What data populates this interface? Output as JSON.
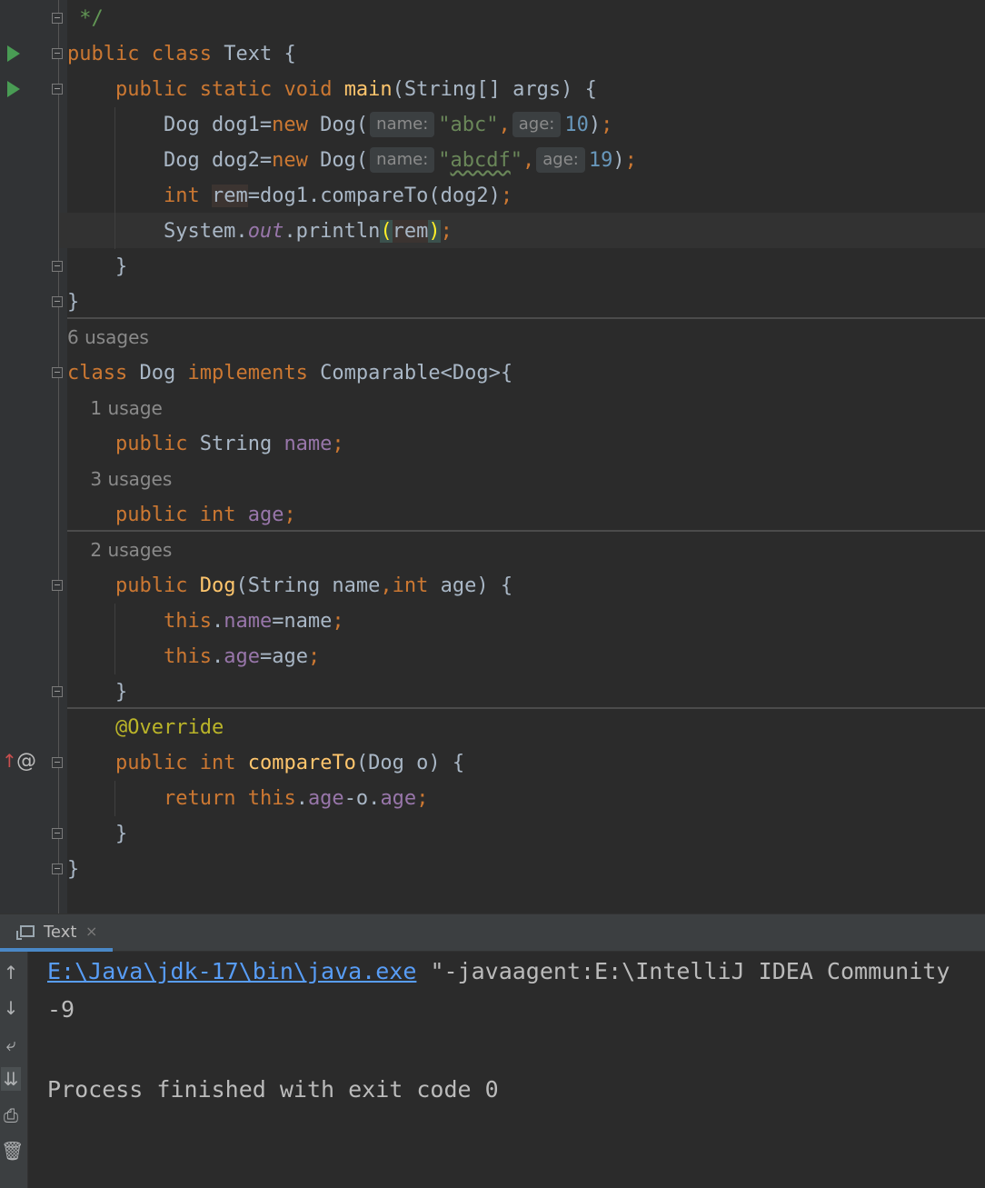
{
  "editor": {
    "lines": [
      {
        "segments": [
          {
            "t": " */",
            "c": "cmt"
          }
        ]
      },
      {
        "segments": [
          {
            "t": "public",
            "c": "kw"
          },
          {
            "t": " "
          },
          {
            "t": "class",
            "c": "kw"
          },
          {
            "t": " Text {"
          }
        ]
      },
      {
        "segments": [
          {
            "t": "    "
          },
          {
            "t": "public",
            "c": "kw"
          },
          {
            "t": " "
          },
          {
            "t": "static",
            "c": "kw"
          },
          {
            "t": " "
          },
          {
            "t": "void",
            "c": "kw"
          },
          {
            "t": " "
          },
          {
            "t": "main",
            "c": "fn"
          },
          {
            "t": "(String[] args) {"
          }
        ]
      },
      {
        "segments": [
          {
            "t": "        Dog dog1="
          },
          {
            "t": "new",
            "c": "kw"
          },
          {
            "t": " Dog("
          },
          {
            "hint": "name:"
          },
          {
            "t": "\"abc\"",
            "c": "str"
          },
          {
            "t": ",",
            "c": "kw"
          },
          {
            "hint": "age:"
          },
          {
            "t": "10",
            "c": "num"
          },
          {
            "t": ")"
          },
          {
            "t": ";",
            "c": "kw"
          }
        ]
      },
      {
        "segments": [
          {
            "t": "        Dog dog2="
          },
          {
            "t": "new",
            "c": "kw"
          },
          {
            "t": " Dog("
          },
          {
            "hint": "name:"
          },
          {
            "t": "\"",
            "c": "str"
          },
          {
            "t": "abcdf",
            "c": "str squiggle"
          },
          {
            "t": "\"",
            "c": "str"
          },
          {
            "t": ",",
            "c": "kw"
          },
          {
            "hint": "age:"
          },
          {
            "t": "19",
            "c": "num"
          },
          {
            "t": ")"
          },
          {
            "t": ";",
            "c": "kw"
          }
        ]
      },
      {
        "segments": [
          {
            "t": "        "
          },
          {
            "t": "int",
            "c": "kw"
          },
          {
            "t": " "
          },
          {
            "t": "rem",
            "c": "rem-hl"
          },
          {
            "t": "=dog1.compareTo(dog2)"
          },
          {
            "t": ";",
            "c": "kw"
          }
        ]
      },
      {
        "segments": [
          {
            "t": "        System."
          },
          {
            "t": "out",
            "c": "static-field"
          },
          {
            "t": ".println"
          },
          {
            "t": "(",
            "c": "bracket-hl"
          },
          {
            "t": "rem",
            "c": "rem-hl"
          },
          {
            "t": ")",
            "c": "bracket-hl"
          },
          {
            "t": ";",
            "c": "kw"
          }
        ]
      },
      {
        "segments": [
          {
            "t": "    }"
          }
        ]
      },
      {
        "segments": [
          {
            "t": "}"
          }
        ]
      },
      {
        "hint_line": "6 usages"
      },
      {
        "segments": [
          {
            "t": "class",
            "c": "kw"
          },
          {
            "t": " Dog "
          },
          {
            "t": "implements",
            "c": "kw"
          },
          {
            "t": " Comparable<Dog>{"
          }
        ]
      },
      {
        "hint_line": "    1 usage"
      },
      {
        "segments": [
          {
            "t": "    "
          },
          {
            "t": "public",
            "c": "kw"
          },
          {
            "t": " String "
          },
          {
            "t": "name",
            "c": "field"
          },
          {
            "t": ";",
            "c": "kw"
          }
        ]
      },
      {
        "hint_line": "    3 usages"
      },
      {
        "segments": [
          {
            "t": "    "
          },
          {
            "t": "public",
            "c": "kw"
          },
          {
            "t": " "
          },
          {
            "t": "int",
            "c": "kw"
          },
          {
            "t": " "
          },
          {
            "t": "age",
            "c": "field"
          },
          {
            "t": ";",
            "c": "kw"
          }
        ]
      },
      {
        "hint_line": "    2 usages"
      },
      {
        "segments": [
          {
            "t": "    "
          },
          {
            "t": "public",
            "c": "kw"
          },
          {
            "t": " "
          },
          {
            "t": "Dog",
            "c": "fn"
          },
          {
            "t": "(String name"
          },
          {
            "t": ",",
            "c": "kw"
          },
          {
            "t": "int",
            "c": "kw"
          },
          {
            "t": " age) {"
          }
        ]
      },
      {
        "segments": [
          {
            "t": "        "
          },
          {
            "t": "this",
            "c": "kw"
          },
          {
            "t": "."
          },
          {
            "t": "name",
            "c": "field"
          },
          {
            "t": "=name"
          },
          {
            "t": ";",
            "c": "kw"
          }
        ]
      },
      {
        "segments": [
          {
            "t": "        "
          },
          {
            "t": "this",
            "c": "kw"
          },
          {
            "t": "."
          },
          {
            "t": "age",
            "c": "field"
          },
          {
            "t": "=age"
          },
          {
            "t": ";",
            "c": "kw"
          }
        ]
      },
      {
        "segments": [
          {
            "t": "    }"
          }
        ]
      },
      {
        "segments": [
          {
            "t": "    "
          },
          {
            "t": "@Override",
            "c": "ann"
          }
        ]
      },
      {
        "segments": [
          {
            "t": "    "
          },
          {
            "t": "public",
            "c": "kw"
          },
          {
            "t": " "
          },
          {
            "t": "int",
            "c": "kw"
          },
          {
            "t": " "
          },
          {
            "t": "compareTo",
            "c": "fn"
          },
          {
            "t": "(Dog o) {"
          }
        ]
      },
      {
        "segments": [
          {
            "t": "        "
          },
          {
            "t": "return",
            "c": "kw"
          },
          {
            "t": " "
          },
          {
            "t": "this",
            "c": "kw"
          },
          {
            "t": "."
          },
          {
            "t": "age",
            "c": "field"
          },
          {
            "t": "-o."
          },
          {
            "t": "age",
            "c": "field"
          },
          {
            "t": ";",
            "c": "kw"
          }
        ]
      },
      {
        "segments": [
          {
            "t": "    }"
          }
        ]
      },
      {
        "segments": [
          {
            "t": "}"
          }
        ]
      }
    ],
    "gutter_icons": {
      "run": "run-arrow-icon",
      "override": "overriding-method-icon",
      "annotation": "at-sign-icon"
    }
  },
  "run_panel": {
    "tab_label": "Text",
    "tab_close": "×",
    "console": {
      "command_link": "E:\\Java\\jdk-17\\bin\\java.exe",
      "command_rest": " \"-javaagent:E:\\IntelliJ IDEA Community",
      "output_value": "-9",
      "exit_message": "Process finished with exit code 0"
    },
    "toolbar_icons": [
      "↑",
      "↓",
      "⤶",
      "⇊",
      "⎙",
      "🗑"
    ]
  },
  "colors": {
    "background": "#2b2b2b",
    "keyword": "#cc7832",
    "string": "#6a8759",
    "number": "#6897bb",
    "function": "#ffc66d",
    "field": "#9876aa",
    "link": "#589df6",
    "accent_tab": "#4a88c7"
  }
}
